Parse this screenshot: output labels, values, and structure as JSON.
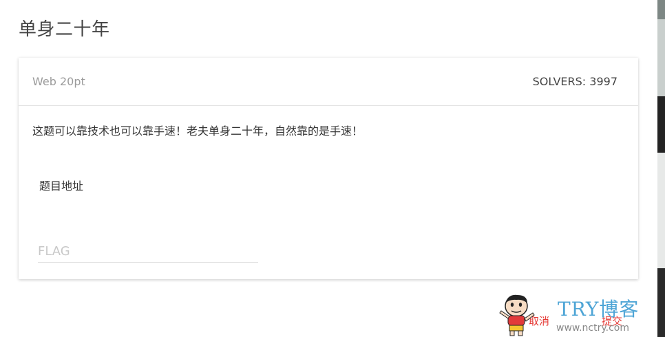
{
  "modal": {
    "title": "单身二十年"
  },
  "challenge": {
    "category": "Web 20pt",
    "solvers": "SOLVERS: 3997",
    "description": "这题可以靠技术也可以靠手速！老夫单身二十年，自然靠的是手速！",
    "link_label": "题目地址"
  },
  "flag_input": {
    "placeholder": "FLAG",
    "value": ""
  },
  "footer": {
    "cancel_label": "取消",
    "submit_label": "提交"
  },
  "watermark": {
    "brand": "TRY博客",
    "url": "www.nctry.com"
  },
  "colors": {
    "action_red": "#e53935",
    "watermark_blue": "#4ea5d6"
  }
}
